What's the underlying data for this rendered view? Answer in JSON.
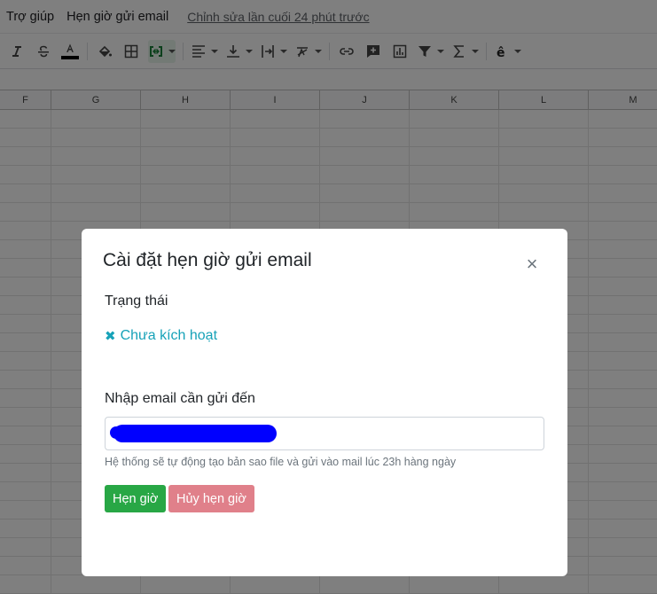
{
  "menubar": {
    "items": [
      "Trợ giúp",
      "Hẹn giờ gửi email"
    ],
    "last_edit": "Chỉnh sửa lần cuối 24 phút trước"
  },
  "toolbar": {
    "icons": [
      "italic-icon",
      "strikethrough-icon",
      "text-color-icon",
      "fill-color-icon",
      "borders-icon",
      "merge-cells-icon",
      "horizontal-align-icon",
      "vertical-align-icon",
      "text-wrap-icon",
      "text-rotation-icon",
      "insert-link-icon",
      "insert-comment-icon",
      "insert-chart-icon",
      "filter-icon",
      "functions-icon",
      "input-tools-icon"
    ]
  },
  "sheet": {
    "columns": [
      "F",
      "G",
      "H",
      "I",
      "J",
      "K",
      "L",
      "M"
    ]
  },
  "modal": {
    "title": "Cài đặt hẹn giờ gửi email",
    "close_symbol": "×",
    "status_label": "Trạng thái",
    "status_icon": "✖",
    "status_value": "Chưa kích hoạt",
    "status_color": "#17a2b8",
    "email_label": "Nhập email cần gửi đến",
    "email_value": "",
    "help_text": "Hệ thống sẽ tự động tạo bản sao file và gửi vào mail lúc 23h hàng ngày",
    "schedule_button": "Hẹn giờ",
    "cancel_button": "Hủy hẹn giờ"
  }
}
